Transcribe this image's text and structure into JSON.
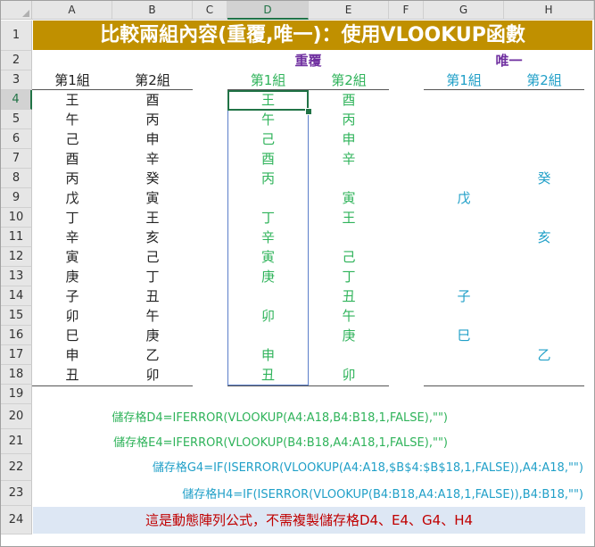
{
  "columns": [
    "A",
    "B",
    "C",
    "D",
    "E",
    "F",
    "G",
    "H"
  ],
  "rows": [
    "1",
    "2",
    "3",
    "4",
    "5",
    "6",
    "7",
    "8",
    "9",
    "10",
    "11",
    "12",
    "13",
    "14",
    "15",
    "16",
    "17",
    "18",
    "19",
    "20",
    "21",
    "22",
    "23",
    "24"
  ],
  "title": "比較兩組內容(重覆,唯一)：使用VLOOKUP函數",
  "section_dup": "重覆",
  "section_unique": "唯一",
  "headers": {
    "a": "第1組",
    "b": "第2組",
    "d": "第1組",
    "e": "第2組",
    "g": "第1組",
    "h": "第2組"
  },
  "col_a": [
    "王",
    "午",
    "己",
    "酉",
    "丙",
    "戊",
    "丁",
    "辛",
    "寅",
    "庚",
    "子",
    "卯",
    "巳",
    "申",
    "丑"
  ],
  "col_b": [
    "酉",
    "丙",
    "申",
    "辛",
    "癸",
    "寅",
    "王",
    "亥",
    "己",
    "丁",
    "丑",
    "午",
    "庚",
    "乙",
    "卯"
  ],
  "col_d": [
    "王",
    "午",
    "己",
    "酉",
    "丙",
    "",
    "丁",
    "辛",
    "寅",
    "庚",
    "",
    "卯",
    "",
    "申",
    "丑"
  ],
  "col_e": [
    "酉",
    "丙",
    "申",
    "辛",
    "",
    "寅",
    "王",
    "",
    "己",
    "丁",
    "丑",
    "午",
    "庚",
    "",
    "卯"
  ],
  "col_g": [
    "",
    "",
    "",
    "",
    "",
    "戊",
    "",
    "",
    "",
    "",
    "子",
    "",
    "巳",
    "",
    ""
  ],
  "col_h": [
    "",
    "",
    "",
    "",
    "癸",
    "",
    "",
    "亥",
    "",
    "",
    "",
    "",
    "",
    "乙",
    ""
  ],
  "formulas": {
    "f20": "儲存格D4=IFERROR(VLOOKUP(A4:A18,B4:B18,1,FALSE),\"\")",
    "f21": "儲存格E4=IFERROR(VLOOKUP(B4:B18,A4:A18,1,FALSE),\"\")",
    "f22": "儲存格G4=IF(ISERROR(VLOOKUP(A4:A18,$B$4:$B$18,1,FALSE)),A4:A18,\"\")",
    "f23": "儲存格H4=IF(ISERROR(VLOOKUP(B4:B18,A4:A18,1,FALSE)),B4:B18,\"\")"
  },
  "note": "這是動態陣列公式，不需複製儲存格D4、E4、G4、H4",
  "selected_cell": "D4",
  "colors": {
    "title_bg": "#c09000",
    "section": "#7030a0",
    "green": "#2fb35a",
    "teal": "#21a0c8",
    "note_bg": "#dde7f4",
    "note_text": "#c00000"
  }
}
